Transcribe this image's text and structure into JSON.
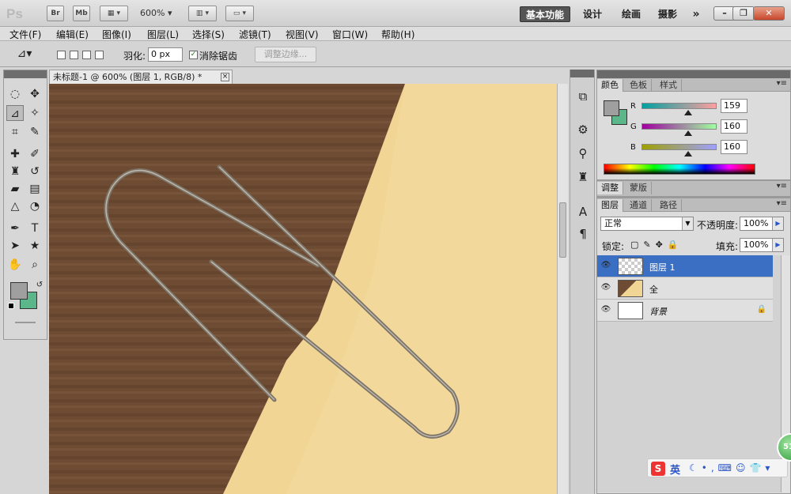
{
  "app": {
    "logo": "Ps",
    "bridge": "Br",
    "minibridge": "Mb",
    "zoom": "600%",
    "workspaces": [
      "基本功能",
      "设计",
      "绘画",
      "摄影"
    ],
    "more": "»"
  },
  "menu": [
    "文件(F)",
    "编辑(E)",
    "图像(I)",
    "图层(L)",
    "选择(S)",
    "滤镜(T)",
    "视图(V)",
    "窗口(W)",
    "帮助(H)"
  ],
  "options": {
    "feather_label": "羽化:",
    "feather_value": "0 px",
    "antialias_label": "消除锯齿",
    "refine_edge": "调整边缘..."
  },
  "document": {
    "tab_title": "未标题-1 @ 600% (图层 1, RGB/8) *",
    "close": "×"
  },
  "color_panel": {
    "tabs": [
      "颜色",
      "色板",
      "样式"
    ],
    "channels": [
      {
        "label": "R",
        "value": "159",
        "level": 0.62
      },
      {
        "label": "G",
        "value": "160",
        "level": 0.63
      },
      {
        "label": "B",
        "value": "160",
        "level": 0.63
      }
    ],
    "foreground": "#9f9f9f",
    "background": "#5bb68a"
  },
  "adjust_panel": {
    "tabs": [
      "调整",
      "蒙版"
    ]
  },
  "layers_panel": {
    "tabs": [
      "图层",
      "通道",
      "路径"
    ],
    "blend_mode": "正常",
    "opacity_label": "不透明度:",
    "opacity": "100%",
    "lock_label": "锁定:",
    "fill_label": "填充:",
    "fill": "100%",
    "layers": [
      {
        "name": "图层 1",
        "selected": true
      },
      {
        "name": "全",
        "selected": false
      },
      {
        "name": "背景",
        "selected": false
      }
    ]
  },
  "ime": {
    "logo": "S",
    "mode": "英"
  },
  "badge": "51"
}
